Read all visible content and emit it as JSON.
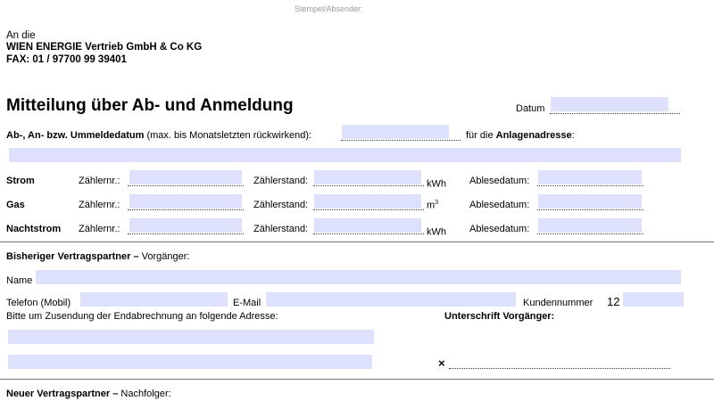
{
  "stamp_label": "Stempel/Absender:",
  "recipient": {
    "line1": "An die",
    "line2": "WIEN ENERGIE Vertrieb GmbH & Co KG",
    "line3": "FAX: 01 / 97700 99 39401"
  },
  "title": "Mitteilung über Ab- und Anmeldung",
  "date_label": "Datum",
  "date_value": "",
  "ummeldedatum": {
    "label_bold": "Ab-, An- bzw. Ummeldedatum",
    "label_note": "(max. bis Monatsletzten rückwirkend):",
    "value": "",
    "for_label": "für die",
    "for_label_bold": "Anlagenadresse",
    "colon": ":",
    "address_value": ""
  },
  "meters": [
    {
      "name": "Strom",
      "meter_label": "Zählernr.:",
      "meter_value": "",
      "reading_label": "Zählerstand:",
      "reading_value": "",
      "unit": "kWh",
      "unit_sup": "",
      "date_label": "Ablesedatum:",
      "date_value": ""
    },
    {
      "name": "Gas",
      "meter_label": "Zählernr.:",
      "meter_value": "",
      "reading_label": "Zählerstand:",
      "reading_value": "",
      "unit": "m",
      "unit_sup": "3",
      "date_label": "Ablesedatum:",
      "date_value": ""
    },
    {
      "name": "Nachtstrom",
      "meter_label": "Zählernr.:",
      "meter_value": "",
      "reading_label": "Zählerstand:",
      "reading_value": "",
      "unit": "kWh",
      "unit_sup": "",
      "date_label": "Ablesedatum:",
      "date_value": ""
    }
  ],
  "previous": {
    "heading_bold": "Bisheriger Vertragspartner –",
    "heading_rest": "Vorgänger:",
    "name_label": "Name",
    "name_value": "",
    "phone_label": "Telefon (Mobil)",
    "phone_value": "",
    "email_label": "E-Mail",
    "email_value": "",
    "customer_label": "Kundennummer",
    "customer_prefix": "12",
    "customer_value": "",
    "final_bill_label": "Bitte um Zusendung der Endabrechnung an folgende Adresse:",
    "address_line1": "",
    "address_line2": "",
    "signature_label": "Unterschrift Vorgänger:",
    "signature_mark": "×"
  },
  "new_partner": {
    "heading_bold": "Neuer Vertragspartner –",
    "heading_rest": "Nachfolger:"
  }
}
